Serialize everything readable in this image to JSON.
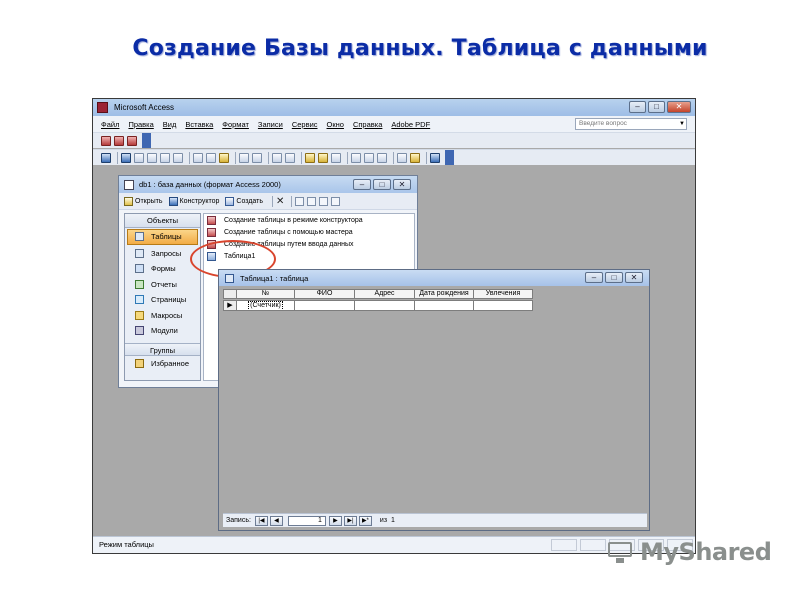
{
  "slide": {
    "title": "Создание Базы данных. Таблица с данными"
  },
  "app": {
    "title": "Microsoft Access",
    "window_buttons": [
      "–",
      "□",
      "✕"
    ],
    "menu": [
      "Файл",
      "Правка",
      "Вид",
      "Вставка",
      "Формат",
      "Записи",
      "Сервис",
      "Окно",
      "Справка",
      "Adobe PDF"
    ],
    "help_placeholder": "Введите вопрос",
    "status": "Режим таблицы"
  },
  "db_window": {
    "title": "db1 : база данных (формат Access 2000)",
    "toolbar": {
      "open": "Открыть",
      "constructor": "Конструктор",
      "create": "Создать"
    },
    "objects_header": "Объекты",
    "objects": [
      {
        "label": "Таблицы",
        "icon": "table-icon",
        "active": true
      },
      {
        "label": "Запросы",
        "icon": "query-icon"
      },
      {
        "label": "Формы",
        "icon": "form-icon"
      },
      {
        "label": "Отчеты",
        "icon": "report-icon"
      },
      {
        "label": "Страницы",
        "icon": "page-icon"
      },
      {
        "label": "Макросы",
        "icon": "macro-icon"
      },
      {
        "label": "Модули",
        "icon": "module-icon"
      }
    ],
    "groups_header": "Группы",
    "groups": [
      {
        "label": "Избранное",
        "icon": "favorites-icon"
      }
    ],
    "list": [
      "Создание таблицы в режиме конструктора",
      "Создание таблицы с помощью мастера",
      "Создание таблицы путем ввода данных",
      "Таблица1"
    ]
  },
  "table_window": {
    "title": "Таблица1 : таблица",
    "columns": [
      "№",
      "ФИО",
      "Адрес",
      "Дата рождения",
      "Увлечения"
    ],
    "row": {
      "selector": "▶",
      "cells": [
        "(Счетчик)",
        "",
        "",
        "",
        ""
      ]
    },
    "nav": {
      "label": "Запись:",
      "current": "1",
      "of_label": "из",
      "total": "1"
    }
  },
  "watermark": {
    "text": "MyShared"
  }
}
